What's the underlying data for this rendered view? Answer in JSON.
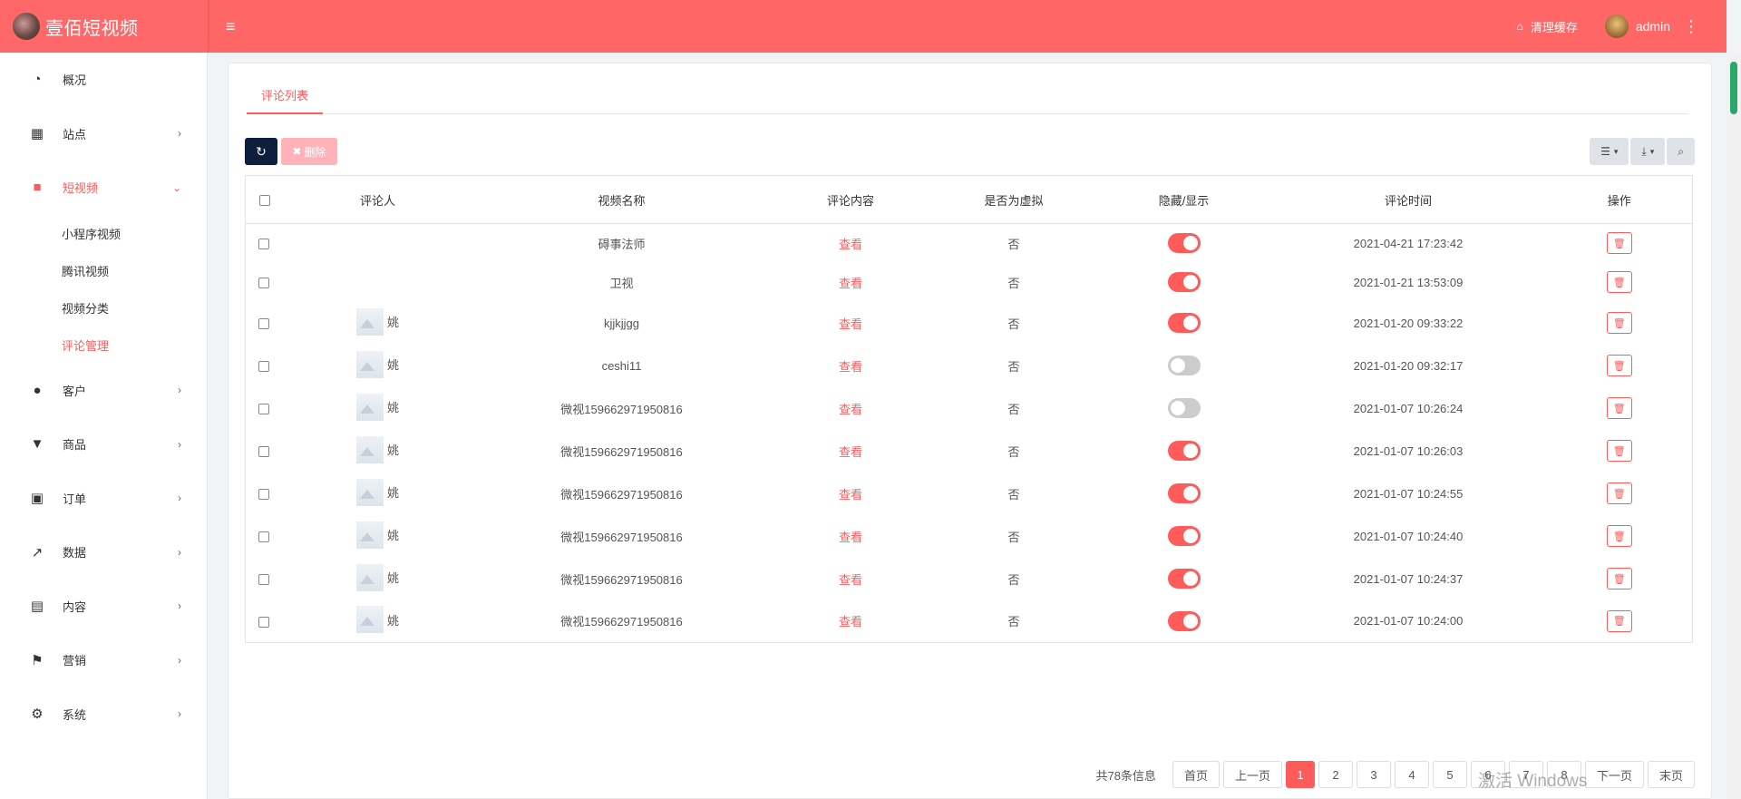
{
  "app": {
    "title": "壹佰短视频",
    "clear_cache": "清理缓存",
    "user": "admin"
  },
  "sidebar": {
    "items": [
      {
        "label": "概况",
        "icon": "dashboard-icon",
        "chevron": false
      },
      {
        "label": "站点",
        "icon": "grid-icon",
        "chevron": true
      },
      {
        "label": "短视频",
        "icon": "video-camera-icon",
        "chevron": true,
        "active": true
      },
      {
        "label": "客户",
        "icon": "users-icon",
        "chevron": true
      },
      {
        "label": "商品",
        "icon": "cart-icon",
        "chevron": true
      },
      {
        "label": "订单",
        "icon": "money-icon",
        "chevron": true
      },
      {
        "label": "数据",
        "icon": "line-chart-icon",
        "chevron": true
      },
      {
        "label": "内容",
        "icon": "document-icon",
        "chevron": true
      },
      {
        "label": "营销",
        "icon": "flag-icon",
        "chevron": true
      },
      {
        "label": "系统",
        "icon": "gear-icon",
        "chevron": true
      }
    ],
    "subitems": [
      "小程序视频",
      "腾讯视频",
      "视频分类",
      "评论管理"
    ]
  },
  "tab": {
    "label": "评论列表"
  },
  "toolbar": {
    "delete_label": "删除"
  },
  "table": {
    "headers": [
      "评论人",
      "视频名称",
      "评论内容",
      "是否为虚拟",
      "隐藏/显示",
      "评论时间",
      "操作"
    ],
    "view_label": "查看",
    "rows": [
      {
        "commenter": "",
        "thumb": false,
        "video": "碍事法师",
        "virtual": "否",
        "visible": true,
        "time": "2021-04-21 17:23:42"
      },
      {
        "commenter": "",
        "thumb": false,
        "video": "卫视",
        "virtual": "否",
        "visible": true,
        "time": "2021-01-21 13:53:09"
      },
      {
        "commenter": "姚",
        "thumb": true,
        "video": "kjjkjjgg",
        "virtual": "否",
        "visible": true,
        "time": "2021-01-20 09:33:22"
      },
      {
        "commenter": "姚",
        "thumb": true,
        "video": "ceshi11",
        "virtual": "否",
        "visible": false,
        "time": "2021-01-20 09:32:17"
      },
      {
        "commenter": "姚",
        "thumb": true,
        "video": "微视15966297195081​6",
        "virtual": "否",
        "visible": false,
        "time": "2021-01-07 10:26:24"
      },
      {
        "commenter": "姚",
        "thumb": true,
        "video": "微视159662971950816",
        "virtual": "否",
        "visible": true,
        "time": "2021-01-07 10:26:03"
      },
      {
        "commenter": "姚",
        "thumb": true,
        "video": "微视159662971950816",
        "virtual": "否",
        "visible": true,
        "time": "2021-01-07 10:24:55"
      },
      {
        "commenter": "姚",
        "thumb": true,
        "video": "微视159662971950816",
        "virtual": "否",
        "visible": true,
        "time": "2021-01-07 10:24:40"
      },
      {
        "commenter": "姚",
        "thumb": true,
        "video": "微视159662971950816",
        "virtual": "否",
        "visible": true,
        "time": "2021-01-07 10:24:37"
      },
      {
        "commenter": "姚",
        "thumb": true,
        "video": "微视159662971950816",
        "virtual": "否",
        "visible": true,
        "time": "2021-01-07 10:24:00"
      }
    ]
  },
  "pagination": {
    "info": "共78条信息",
    "first": "首页",
    "prev": "上一页",
    "pages": [
      "1",
      "2",
      "3",
      "4",
      "5",
      "6",
      "7",
      "8"
    ],
    "current": "1",
    "next": "下一页",
    "last": "末页"
  },
  "watermark": "激活 Windows",
  "colors": {
    "accent": "#ff5b5b",
    "topbar": "#ff6666",
    "dark_button": "#0d1f3c"
  }
}
